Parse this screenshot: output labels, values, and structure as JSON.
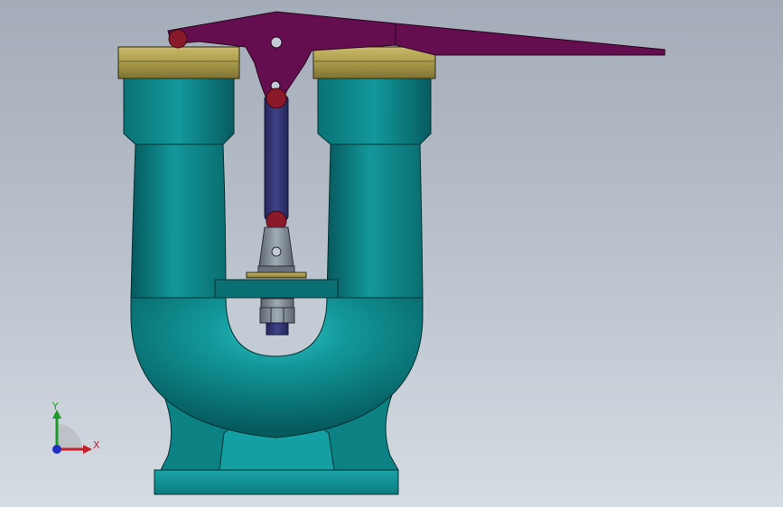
{
  "viewport": {
    "background_top": "#a3acb8",
    "background_bottom": "#d6dce3"
  },
  "model": {
    "parts": [
      "valve-body",
      "inlet-flange",
      "outlet-flange",
      "left-gland-nut",
      "right-gland-nut",
      "lever-arm",
      "link-rod",
      "clevis",
      "gate-plate",
      "hex-nut",
      "base-flange"
    ],
    "colors": {
      "body_teal": "#0e8a8d",
      "body_teal_dark": "#06595d",
      "body_teal_light": "#20b2b6",
      "brass": "#a89a4a",
      "lever_magenta": "#6b0f52",
      "rod_blue": "#32346e",
      "pin_red": "#8a1a2a",
      "steel_grey": "#7c8690"
    }
  },
  "triad": {
    "x_label": "X",
    "y_label": "Y",
    "x_color": "#c8202a",
    "y_color": "#1f9a2a",
    "z_color": "#2030c0"
  }
}
